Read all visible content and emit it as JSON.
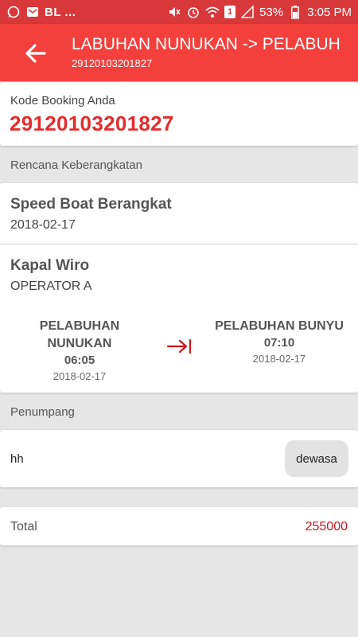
{
  "status_bar": {
    "left_text": "BL ...",
    "battery": "53%",
    "time": "3:05 PM",
    "sim_badge": "1",
    "icons": [
      "whatsapp-icon",
      "mail-icon",
      "mute-icon",
      "alarm-icon",
      "wifi-icon",
      "signal-icon",
      "battery-icon"
    ]
  },
  "app_bar": {
    "title": "LABUHAN NUNUKAN -> PELABUH",
    "subtitle": "29120103201827",
    "color": "#f3403c"
  },
  "booking": {
    "label": "Kode Booking Anda",
    "code": "29120103201827"
  },
  "plan": {
    "section_label": "Rencana Keberangkatan",
    "type": "Speed Boat Berangkat",
    "date": "2018-02-17",
    "ship": "Kapal Wiro",
    "operator": "OPERATOR A",
    "origin": {
      "name": "PELABUHAN NUNUKAN",
      "time": "06:05",
      "date": "2018-02-17"
    },
    "destination": {
      "name": "PELABUHAN BUNYU",
      "time": "07:10",
      "date": "2018-02-17"
    }
  },
  "passengers": {
    "section_label": "Penumpang",
    "items": [
      {
        "name": "hh",
        "category": "dewasa"
      }
    ]
  },
  "total": {
    "label": "Total",
    "value": "255000"
  }
}
